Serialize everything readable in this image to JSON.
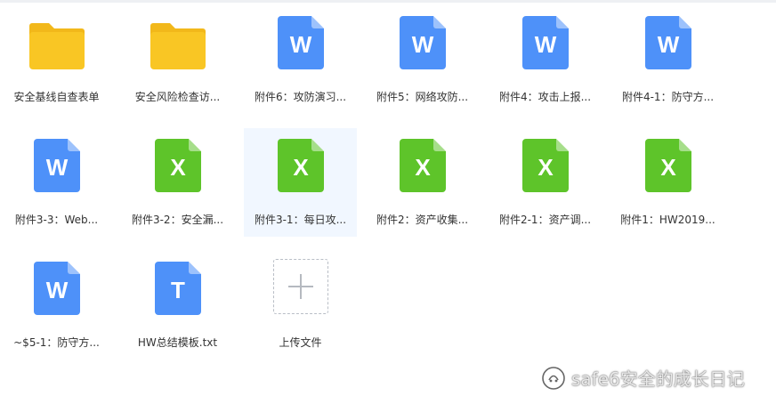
{
  "files": [
    {
      "type": "folder",
      "name": "安全基线自查表单"
    },
    {
      "type": "folder",
      "name": "安全风险检查访..."
    },
    {
      "type": "word",
      "name": "附件6：攻防演习..."
    },
    {
      "type": "word",
      "name": "附件5：网络攻防..."
    },
    {
      "type": "word",
      "name": "附件4：攻击上报..."
    },
    {
      "type": "word",
      "name": "附件4-1：防守方..."
    },
    {
      "type": "word",
      "name": "附件3-3：Web..."
    },
    {
      "type": "excel",
      "name": "附件3-2：安全漏..."
    },
    {
      "type": "excel",
      "name": "附件3-1：每日攻...",
      "selected": true
    },
    {
      "type": "excel",
      "name": "附件2：资产收集..."
    },
    {
      "type": "excel",
      "name": "附件2-1：资产调..."
    },
    {
      "type": "excel",
      "name": "附件1：HW2019..."
    },
    {
      "type": "word",
      "name": "~$5-1：防守方..."
    },
    {
      "type": "text",
      "name": "HW总结模板.txt"
    }
  ],
  "icons": {
    "folder": "W",
    "word": "W",
    "excel": "X",
    "text": "T"
  },
  "upload": {
    "label": "上传文件"
  },
  "watermark": {
    "text": "safe6安全的成长日记"
  },
  "colors": {
    "folder": "#f9c624",
    "folder_tab": "#f2b81a",
    "word": "#4e91f9",
    "excel": "#5ec42a",
    "text": "#4e91f9",
    "fold": "rgba(255,255,255,0.45)",
    "selected_bg": "#f1f7ff"
  }
}
